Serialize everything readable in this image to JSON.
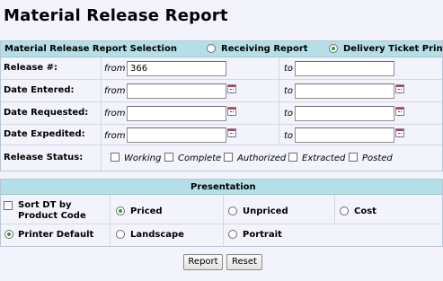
{
  "title": "Material Release Report",
  "selection": {
    "header": "Material Release Report Selection",
    "report_options": [
      {
        "label": "Receiving Report",
        "selected": false
      },
      {
        "label": "Delivery Ticket Print",
        "selected": true
      }
    ]
  },
  "fields": {
    "from_label": "from",
    "to_label": "to",
    "release_no": {
      "label": "Release #:",
      "from": "366",
      "to": ""
    },
    "date_entered": {
      "label": "Date Entered:",
      "from": "",
      "to": ""
    },
    "date_requested": {
      "label": "Date Requested:",
      "from": "",
      "to": ""
    },
    "date_expedited": {
      "label": "Date Expedited:",
      "from": "",
      "to": ""
    },
    "release_status": {
      "label": "Release Status:",
      "options": [
        "Working",
        "Complete",
        "Authorized",
        "Extracted",
        "Posted"
      ]
    }
  },
  "presentation": {
    "header": "Presentation",
    "sort_label": "Sort DT by Product Code",
    "pricing": [
      {
        "label": "Priced",
        "selected": true
      },
      {
        "label": "Unpriced",
        "selected": false
      },
      {
        "label": "Cost",
        "selected": false
      }
    ],
    "layout": [
      {
        "label": "Printer Default",
        "selected": true
      },
      {
        "label": "Landscape",
        "selected": false
      },
      {
        "label": "Portrait",
        "selected": false
      }
    ]
  },
  "buttons": {
    "report": "Report",
    "reset": "Reset"
  }
}
